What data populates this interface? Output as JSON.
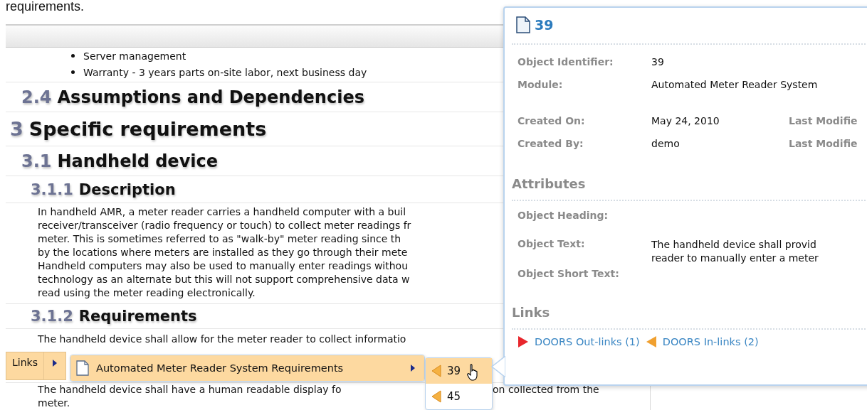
{
  "page_top_text": "requirements.",
  "document": {
    "blocks": [
      {
        "kind": "bullets",
        "items": [
          "Server management",
          "Warranty - 3 years parts on-site labor, next business day"
        ]
      },
      {
        "kind": "h2",
        "number": "2.4",
        "title": "Assumptions and Dependencies"
      },
      {
        "kind": "h1",
        "number": "3",
        "title": "Specific requirements"
      },
      {
        "kind": "h2",
        "number": "3.1",
        "title": "Handheld device"
      },
      {
        "kind": "h3",
        "number": "3.1.1",
        "title": "Description"
      },
      {
        "kind": "paragraph",
        "lines": [
          [
            "In handheld AMR, a meter reader carries a handheld computer with a buil"
          ],
          [
            "receiver/transceiver (radio frequency or touch) to collect meter readings fr"
          ],
          [
            "meter. This is sometimes referred to as \"walk-by\" meter reading since th"
          ],
          [
            "by the locations where meters are installed as they go through their mete"
          ],
          [
            "Handheld computers may also be used to manually enter readings withou"
          ],
          [
            "technology as an alternate but this will not support comprehensive data w"
          ],
          [
            "read using the meter reading electronically."
          ]
        ]
      },
      {
        "kind": "h3",
        "number": "3.1.2",
        "title": "Requirements"
      },
      {
        "kind": "paragraph",
        "lines": [
          [
            "The handheld device shall allow for the meter reader to collect informatio"
          ]
        ]
      },
      {
        "kind": "paragraph",
        "lines": [
          [
            "The handheld device shall have a human readable display fo",
            "on collected from the"
          ],
          [
            "meter."
          ]
        ]
      }
    ]
  },
  "links_bar": {
    "label": "Links",
    "module_menu": [
      {
        "title": "Automated Meter Reader System Requirements",
        "selected": true
      }
    ],
    "object_menu": [
      {
        "label": "39",
        "selected": true
      },
      {
        "label": "45",
        "selected": false
      }
    ]
  },
  "popup": {
    "title": "39",
    "properties": [
      {
        "label": "Object Identifier:",
        "value": "39"
      },
      {
        "label": "Module:",
        "value": "Automated Meter Reader System"
      },
      {
        "label": "Created On:",
        "value": "May 24, 2010",
        "extra_label": "Last Modifie"
      },
      {
        "label": "Created By:",
        "value": "demo",
        "extra_label": "Last Modifie"
      }
    ],
    "attributes_heading": "Attributes",
    "attributes": [
      {
        "label": "Object Heading:"
      },
      {
        "label": "Object Text:",
        "lines": [
          "The handheld device shall provid",
          "reader to manually enter a meter"
        ]
      },
      {
        "label": "Object Short Text:"
      }
    ],
    "links_heading": "Links",
    "links": [
      {
        "kind": "out",
        "label": "DOORS Out-links (1)"
      },
      {
        "kind": "in",
        "label": "DOORS In-links (2)"
      }
    ]
  }
}
